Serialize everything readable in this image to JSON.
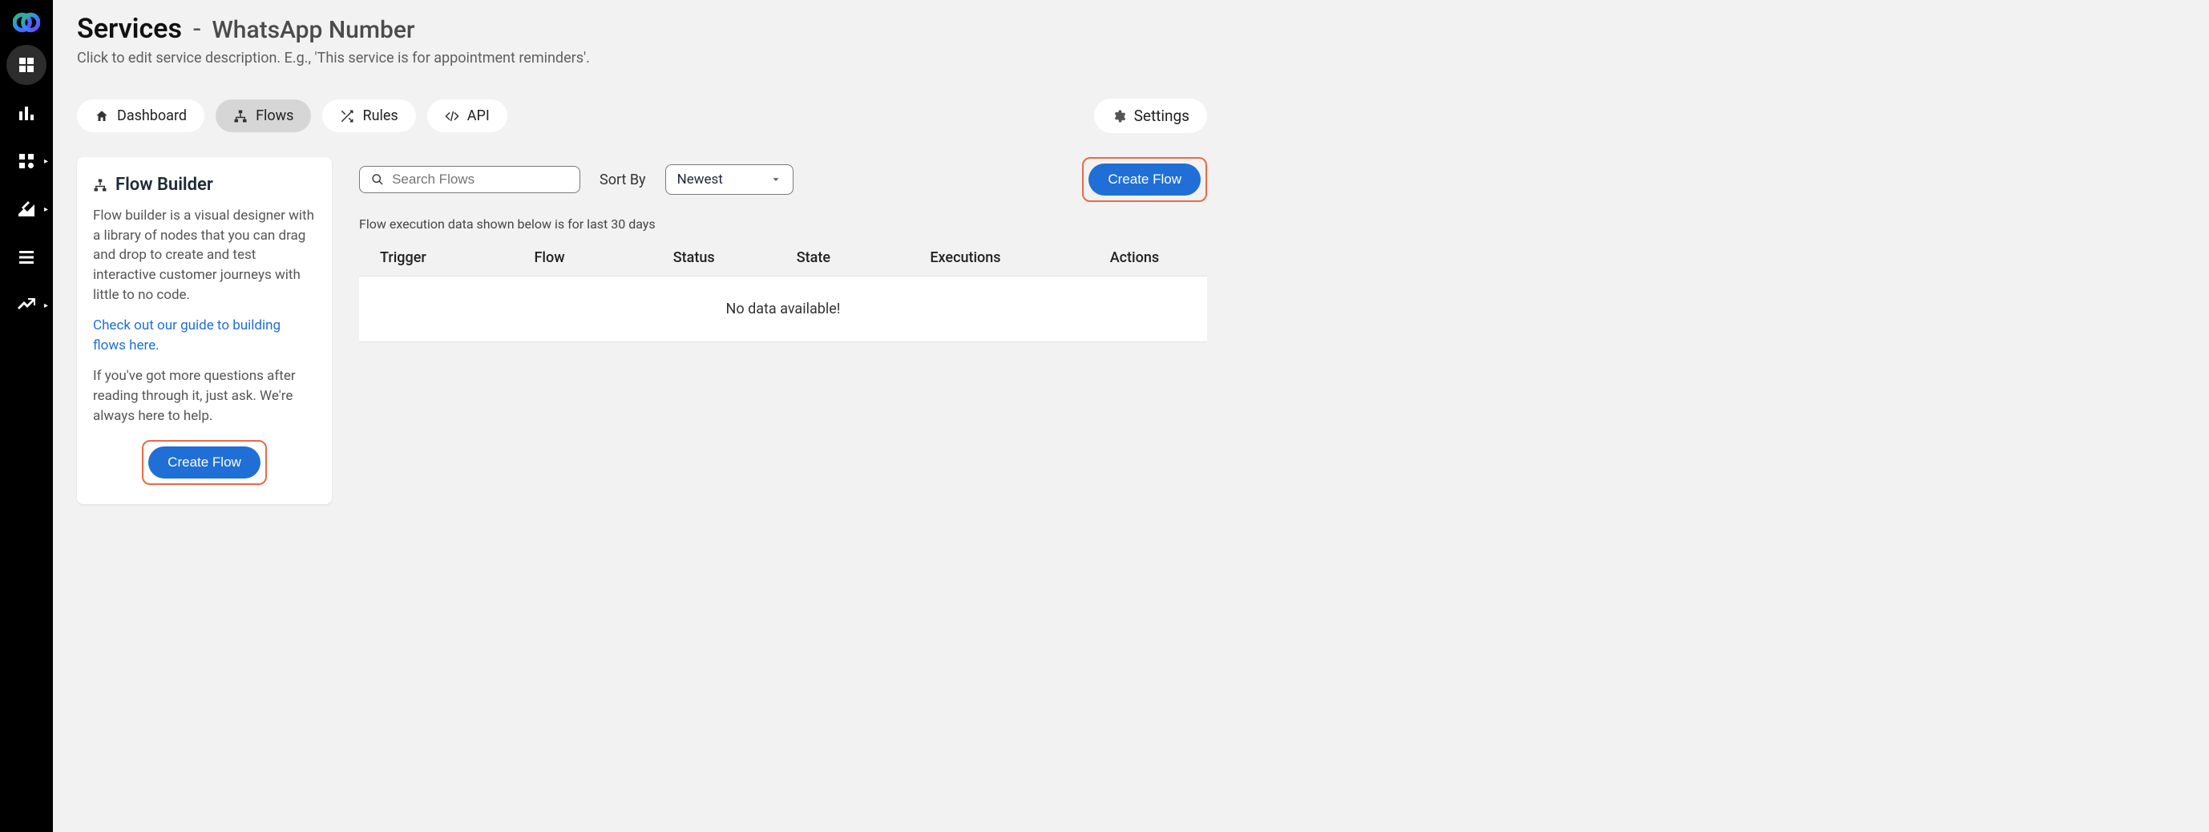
{
  "sidebar": {
    "items": [
      {
        "name": "dashboard",
        "active": true
      },
      {
        "name": "analytics",
        "active": false
      },
      {
        "name": "apps",
        "active": false,
        "caret": true
      },
      {
        "name": "tools",
        "active": false,
        "caret": true
      },
      {
        "name": "logs",
        "active": false
      },
      {
        "name": "growth",
        "active": false,
        "caret": true
      }
    ]
  },
  "header": {
    "services_label": "Services",
    "dash": "-",
    "service_name": "WhatsApp Number",
    "subtitle": "Click to edit service description. E.g., 'This service is for appointment reminders'."
  },
  "tabs": {
    "dashboard": "Dashboard",
    "flows": "Flows",
    "rules": "Rules",
    "api": "API"
  },
  "settings_label": "Settings",
  "flow_builder": {
    "title": "Flow Builder",
    "desc": "Flow builder is a visual designer with a library of nodes that you can drag and drop to create and test interactive customer journeys with little to no code.",
    "guide_link": "Check out our guide to building flows here.",
    "help_text": "If you've got more questions after reading through it, just ask. We're always here to help.",
    "create_btn": "Create Flow"
  },
  "search": {
    "placeholder": "Search Flows"
  },
  "sort": {
    "label": "Sort By",
    "value": "Newest"
  },
  "create_top_btn": "Create Flow",
  "exec_note": "Flow execution data shown below is for last 30 days",
  "table": {
    "headers": {
      "trigger": "Trigger",
      "flow": "Flow",
      "status": "Status",
      "state": "State",
      "executions": "Executions",
      "actions": "Actions"
    },
    "empty_msg": "No data available!"
  }
}
